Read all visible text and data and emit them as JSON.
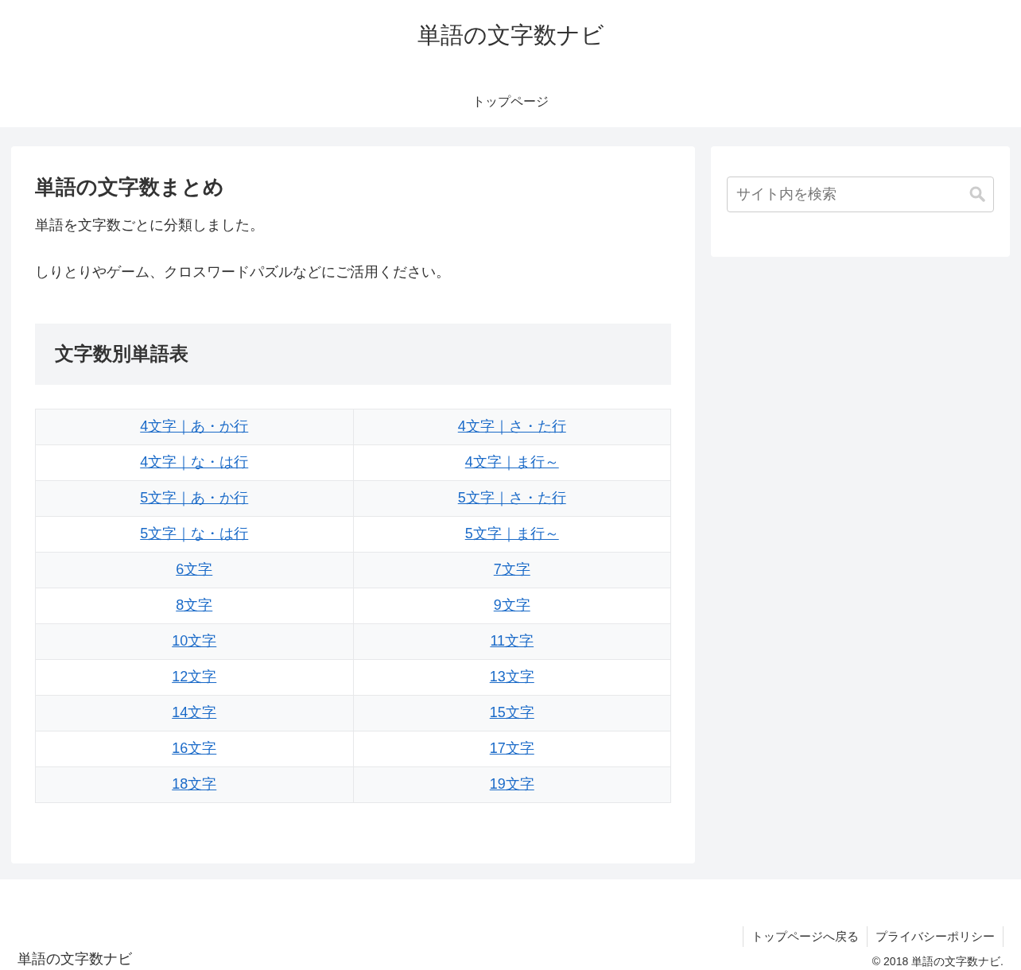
{
  "site_title": "単語の文字数ナビ",
  "nav": [
    "トップページ"
  ],
  "article": {
    "title": "単語の文字数まとめ",
    "paragraphs": [
      "単語を文字数ごとに分類しました。",
      "しりとりやゲーム、クロスワードパズルなどにご活用ください。"
    ],
    "section_heading": "文字数別単語表",
    "table_rows": [
      [
        "4文字｜あ・か行",
        "4文字｜さ・た行"
      ],
      [
        "4文字｜な・は行",
        "4文字｜ま行～"
      ],
      [
        "5文字｜あ・か行",
        "5文字｜さ・た行"
      ],
      [
        "5文字｜な・は行",
        "5文字｜ま行～"
      ],
      [
        "6文字",
        "7文字"
      ],
      [
        "8文字",
        "9文字"
      ],
      [
        "10文字",
        "11文字"
      ],
      [
        "12文字",
        "13文字"
      ],
      [
        "14文字",
        "15文字"
      ],
      [
        "16文字",
        "17文字"
      ],
      [
        "18文字",
        "19文字"
      ]
    ]
  },
  "sidebar": {
    "search": {
      "placeholder": "サイト内を検索"
    }
  },
  "footer": {
    "links": [
      "トップページへ戻る",
      "プライバシーポリシー"
    ],
    "site_name": "単語の文字数ナビ",
    "copyright": "© 2018 単語の文字数ナビ."
  }
}
